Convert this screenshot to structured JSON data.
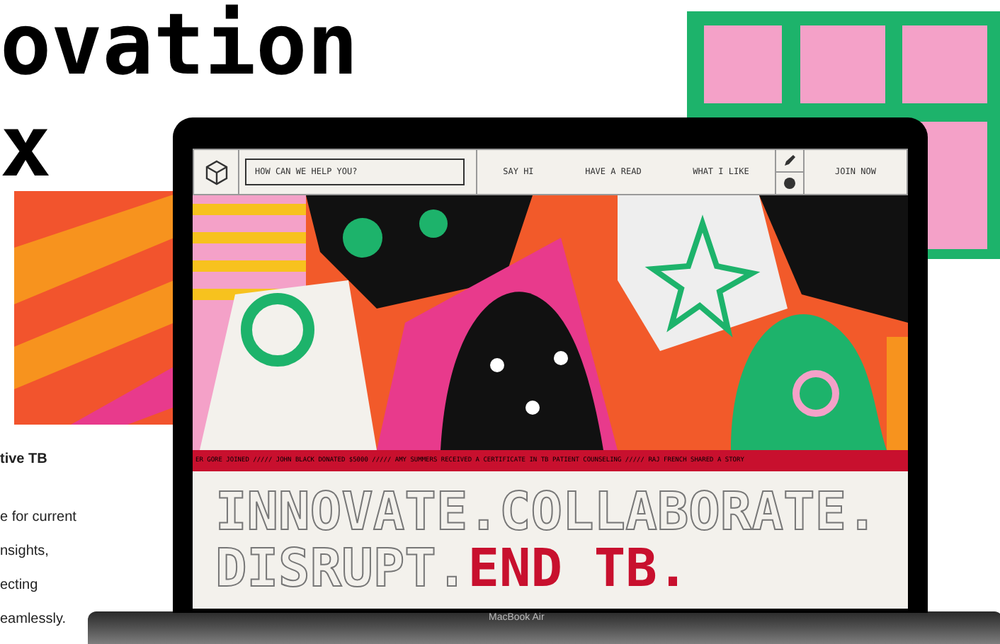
{
  "heading": {
    "lines": [
      "ovation",
      "x"
    ]
  },
  "side_text": {
    "title": "tive TB",
    "lines": [
      "e for current",
      "nsights,",
      "ecting",
      "eamlessly."
    ]
  },
  "laptop": {
    "label": "MacBook Air",
    "nav": {
      "search": {
        "placeholder": "HOW CAN WE HELP YOU?"
      },
      "links": [
        "SAY HI",
        "HAVE A READ",
        "WHAT I LIKE"
      ],
      "join": "JOIN NOW"
    },
    "ticker": "ER GORE JOINED ///// JOHN BLACK DONATED $5000 ///// AMY SUMMERS RECEIVED A CERTIFICATE IN TB PATIENT COUNSELING ///// RAJ FRENCH SHARED A STORY",
    "hero": {
      "outline_lines": [
        "INNOVATE.COLLABORATE.",
        "DISRUPT."
      ],
      "highlight": "END TB."
    }
  }
}
